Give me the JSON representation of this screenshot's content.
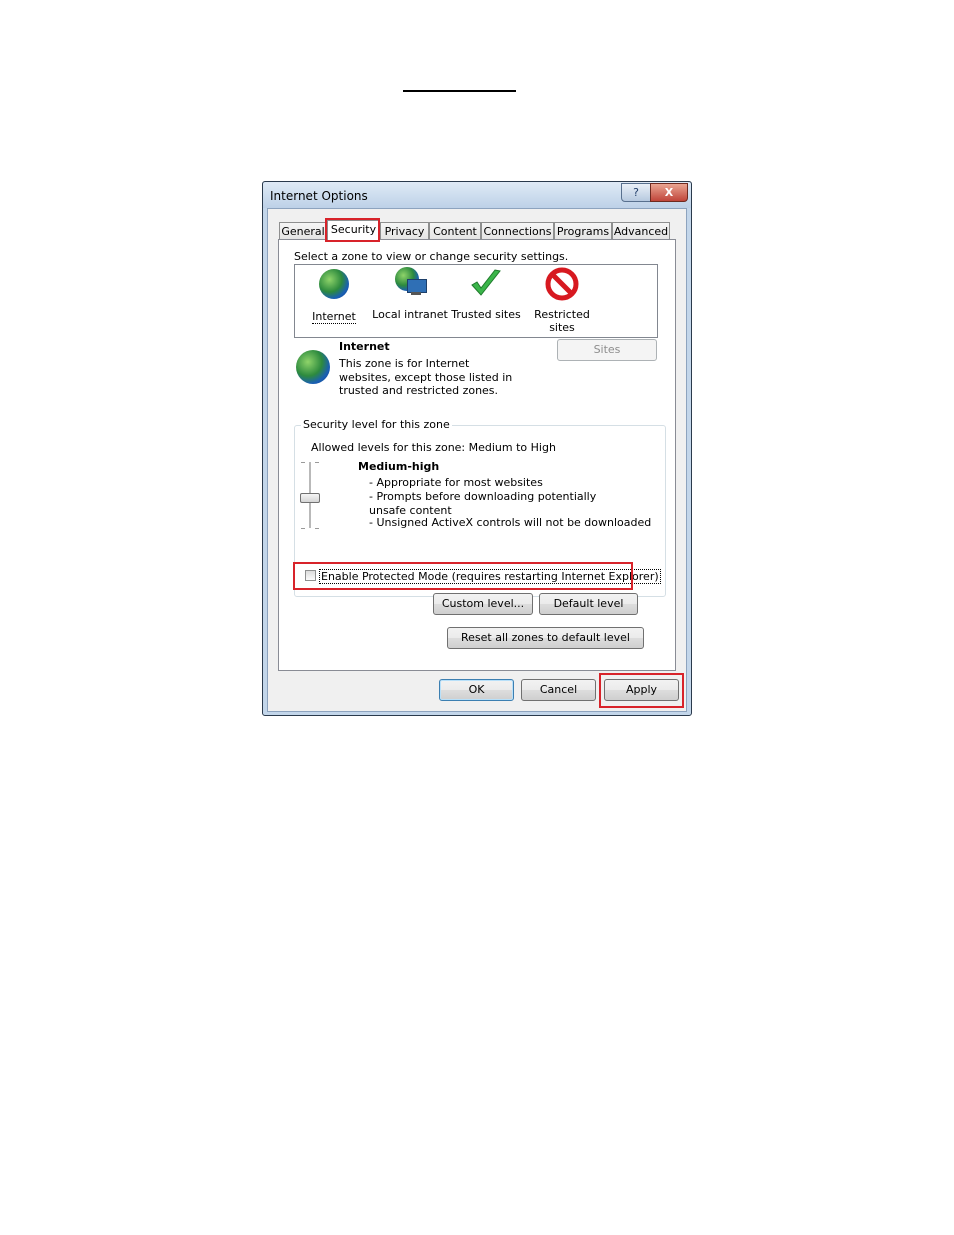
{
  "dialog": {
    "title": "Internet Options",
    "help_glyph": "?",
    "close_glyph": "X"
  },
  "tabs": [
    "General",
    "Security",
    "Privacy",
    "Content",
    "Connections",
    "Programs",
    "Advanced"
  ],
  "active_tab": "Security",
  "zones": {
    "prompt": "Select a zone to view or change security settings.",
    "items": [
      {
        "label": "Internet",
        "icon": "globe-icon"
      },
      {
        "label": "Local intranet",
        "icon": "intranet-icon"
      },
      {
        "label": "Trusted sites",
        "icon": "checkmark-icon"
      },
      {
        "label": "Restricted sites",
        "icon": "restricted-icon"
      }
    ],
    "selected": "Internet"
  },
  "zone_info": {
    "name": "Internet",
    "description": "This zone is for Internet websites, except those listed in trusted and restricted zones.",
    "sites_button": "Sites"
  },
  "security_level": {
    "group_title": "Security level for this zone",
    "allowed": "Allowed levels for this zone: Medium to High",
    "level_name": "Medium-high",
    "bullets": [
      "- Appropriate for most websites",
      "- Prompts before downloading potentially unsafe content",
      "- Unsigned ActiveX controls will not be downloaded"
    ],
    "protected_mode_label": "Enable Protected Mode (requires restarting Internet Explorer)",
    "protected_mode_checked": false,
    "custom_level_button": "Custom level...",
    "default_level_button": "Default level"
  },
  "reset_button": "Reset all zones to default level",
  "footer": {
    "ok": "OK",
    "cancel": "Cancel",
    "apply": "Apply"
  },
  "colors": {
    "highlight_red": "#d8232a",
    "title_bar": "#c3d6ea",
    "close_button": "#c0453a"
  }
}
